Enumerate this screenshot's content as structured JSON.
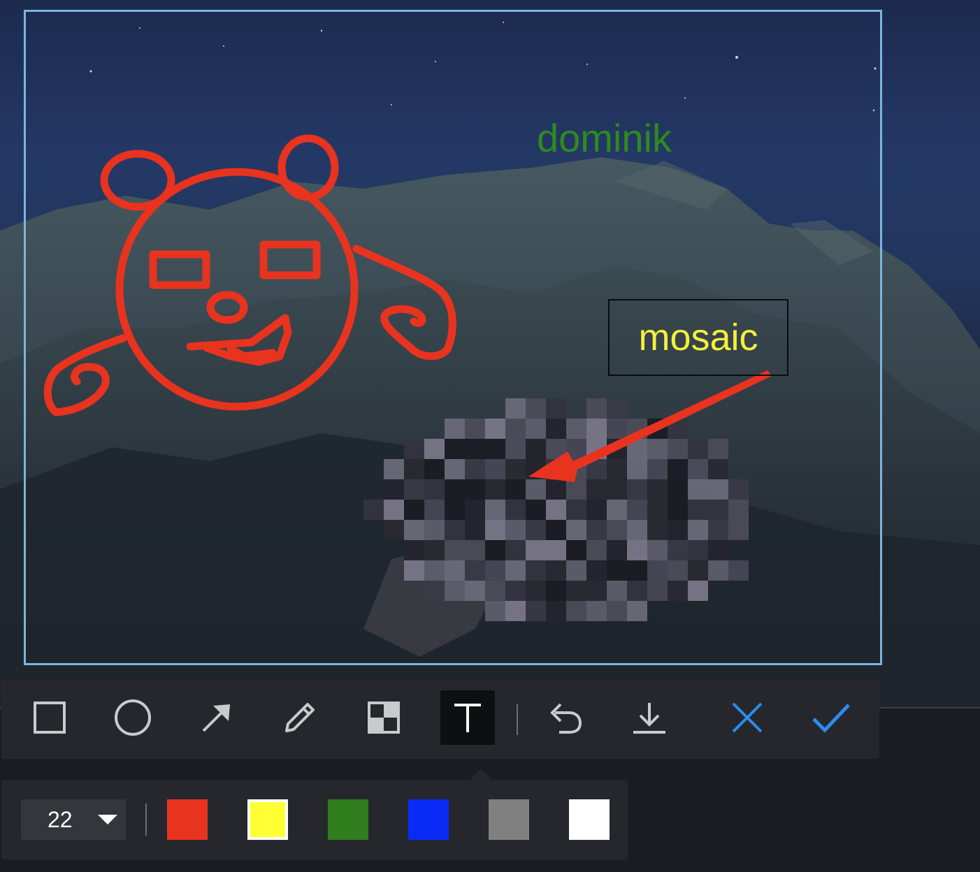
{
  "canvas": {
    "annotations": {
      "text_green": "dominik",
      "text_box": "mosaic"
    },
    "colors": {
      "selection_border": "#7ab6dd",
      "drawing_red": "#e8331f",
      "text_green": "#2e8b1e",
      "text_yellow": "#f4f03a"
    }
  },
  "toolbar": {
    "tools": [
      {
        "name": "rectangle",
        "icon": "rectangle-icon",
        "active": false
      },
      {
        "name": "ellipse",
        "icon": "circle-icon",
        "active": false
      },
      {
        "name": "arrow",
        "icon": "arrow-icon",
        "active": false
      },
      {
        "name": "brush",
        "icon": "pencil-icon",
        "active": false
      },
      {
        "name": "mosaic",
        "icon": "mosaic-icon",
        "active": false
      },
      {
        "name": "text",
        "icon": "text-icon",
        "active": true
      }
    ],
    "actions": [
      {
        "name": "undo",
        "icon": "undo-icon"
      },
      {
        "name": "save",
        "icon": "download-icon"
      },
      {
        "name": "cancel",
        "icon": "close-icon",
        "color": "#2d8cf0"
      },
      {
        "name": "confirm",
        "icon": "check-icon",
        "color": "#2d8cf0"
      }
    ]
  },
  "text_options": {
    "font_size": "22",
    "colors": [
      {
        "hex": "#e8331f",
        "selected": false
      },
      {
        "hex": "#ffff33",
        "selected": true
      },
      {
        "hex": "#2f7d1c",
        "selected": false
      },
      {
        "hex": "#0a2af5",
        "selected": false
      },
      {
        "hex": "#808080",
        "selected": false
      },
      {
        "hex": "#ffffff",
        "selected": false
      }
    ]
  }
}
